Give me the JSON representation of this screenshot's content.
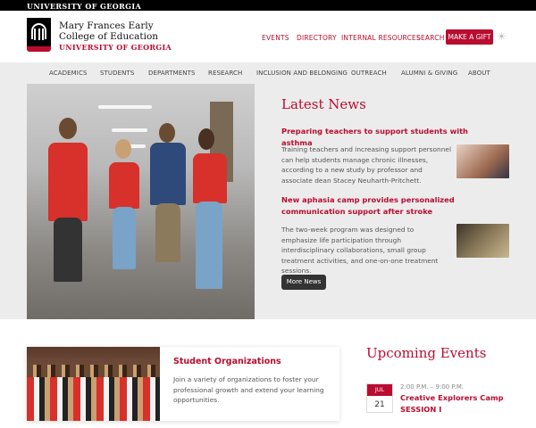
{
  "topbar": {
    "text": "UNIVERSITY OF GEORGIA"
  },
  "header": {
    "name": "Mary Frances Early\nCollege of Education",
    "name_line1": "Mary Frances Early",
    "name_line2": "College of Education",
    "subname": "UNIVERSITY OF GEORGIA",
    "links": [
      "EVENTS",
      "DIRECTORY",
      "INTERNAL RESOURCES",
      "SEARCH"
    ],
    "gift_label": "MAKE A GIFT"
  },
  "nav": {
    "items": [
      "ACADEMICS",
      "STUDENTS",
      "DEPARTMENTS",
      "RESEARCH",
      "INCLUSION AND BELONGING",
      "OUTREACH",
      "ALUMNI & GIVING",
      "ABOUT"
    ]
  },
  "news": {
    "title": "Latest News",
    "items": [
      {
        "headline": "Preparing teachers to support students with asthma",
        "body": "Training teachers and increasing support personnel can help students manage chronic illnesses, according to a new study by professor and associate dean Stacey Neuharth-Pritchett."
      },
      {
        "headline": "New aphasia camp provides personalized communication support after stroke",
        "body": "The two-week program was designed to emphasize life participation through interdisciplinary collaborations, small group treatment activities, and one-on-one treatment sessions."
      }
    ],
    "more_label": "More News"
  },
  "org_card": {
    "title": "Student Organizations",
    "body": "Join a variety of organizations to foster your professional growth and extend your learning opportunities."
  },
  "events": {
    "title": "Upcoming Events",
    "items": [
      {
        "month": "JUL",
        "day": "21",
        "time": "2:00 P.M. – 9:00 P.M.",
        "name": "Creative Explorers Camp SESSION I"
      }
    ]
  },
  "colors": {
    "accent": "#ba0c2f",
    "topbar": "#000000",
    "nav_bg": "#ececec"
  }
}
